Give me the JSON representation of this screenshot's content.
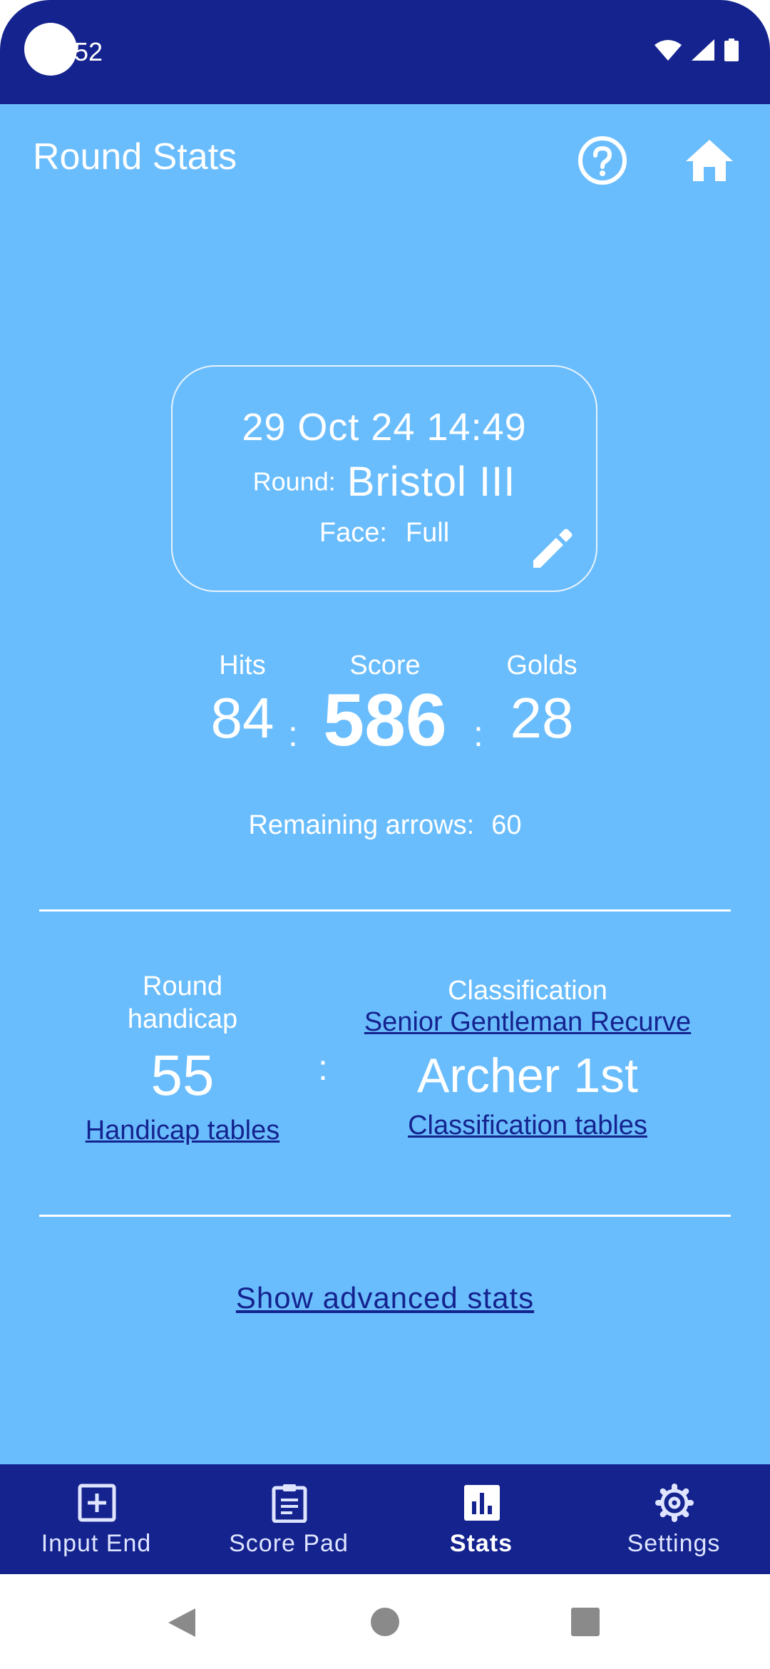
{
  "status": {
    "time": "52"
  },
  "appbar": {
    "title": "Round Stats",
    "help_icon": "help-icon",
    "home_icon": "home-icon"
  },
  "card": {
    "datetime": "29 Oct 24 14:49",
    "round_label": "Round:",
    "round_value": "Bristol III",
    "face_label": "Face:",
    "face_value": "Full"
  },
  "stats": {
    "hits_label": "Hits",
    "hits": "84",
    "score_label": "Score",
    "score": "586",
    "golds_label": "Golds",
    "golds": "28",
    "sep": ":",
    "remaining_label": "Remaining arrows:",
    "remaining": "60"
  },
  "handicap": {
    "label_line1": "Round",
    "label_line2": "handicap",
    "value": "55",
    "tables_link": "Handicap tables"
  },
  "classification": {
    "label": "Classification",
    "category_link": "Senior Gentleman Recurve",
    "value": "Archer 1st",
    "tables_link": "Classification tables"
  },
  "advanced_link": "Show advanced stats",
  "nav": [
    {
      "label": "Input End",
      "icon": "add-box-icon"
    },
    {
      "label": "Score Pad",
      "icon": "clipboard-icon"
    },
    {
      "label": "Stats",
      "icon": "bar-chart-icon",
      "active": true
    },
    {
      "label": "Settings",
      "icon": "gear-icon"
    }
  ],
  "colors": {
    "primary_dark": "#14238e",
    "background": "#6abdfd",
    "link": "#14238e"
  }
}
